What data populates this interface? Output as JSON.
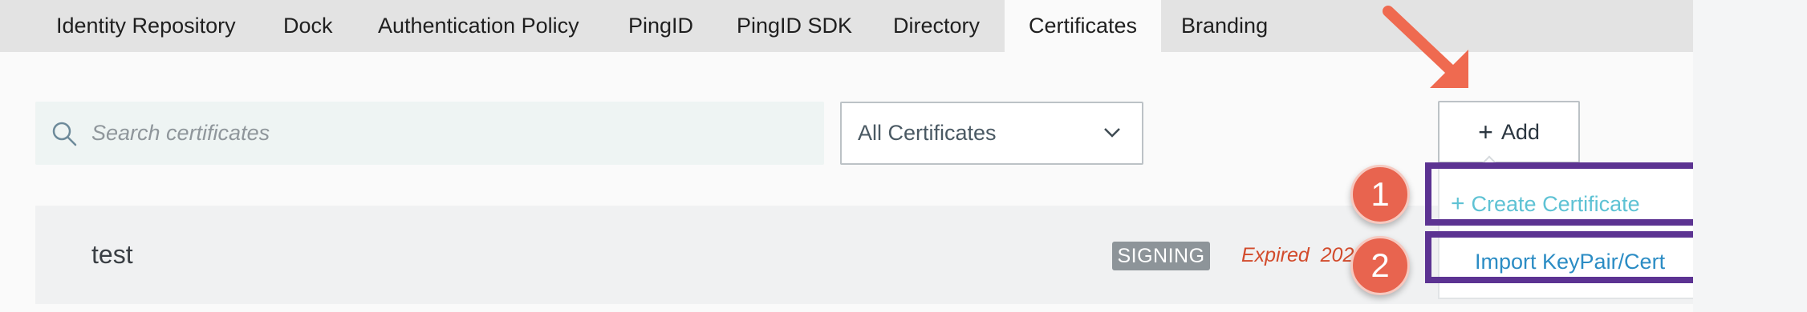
{
  "tabs": [
    {
      "label": "Identity Repository",
      "active": false
    },
    {
      "label": "Dock",
      "active": false
    },
    {
      "label": "Authentication Policy",
      "active": false
    },
    {
      "label": "PingID",
      "active": false
    },
    {
      "label": "PingID SDK",
      "active": false
    },
    {
      "label": "Directory",
      "active": false
    },
    {
      "label": "Certificates",
      "active": true
    },
    {
      "label": "Branding",
      "active": false
    }
  ],
  "toolbar": {
    "search_placeholder": "Search certificates",
    "search_icon": "search-icon",
    "filter_value": "All Certificates",
    "add_label": "Add"
  },
  "add_menu": {
    "items": [
      {
        "label": "Create Certificate",
        "icon": "plus-icon"
      },
      {
        "label": "Import KeyPair/Cert"
      }
    ]
  },
  "callouts": {
    "step1": "1",
    "step2": "2"
  },
  "certificates": [
    {
      "name": "test",
      "type": "SIGNING",
      "status": "Expired  202"
    }
  ],
  "colors": {
    "highlight_box": "#5c3392",
    "callout_circle": "#e8644f",
    "arrow": "#ef6a50",
    "expired_text": "#d24b2c",
    "menu_create": "#5ec2d4",
    "menu_import": "#2b8cc4"
  }
}
